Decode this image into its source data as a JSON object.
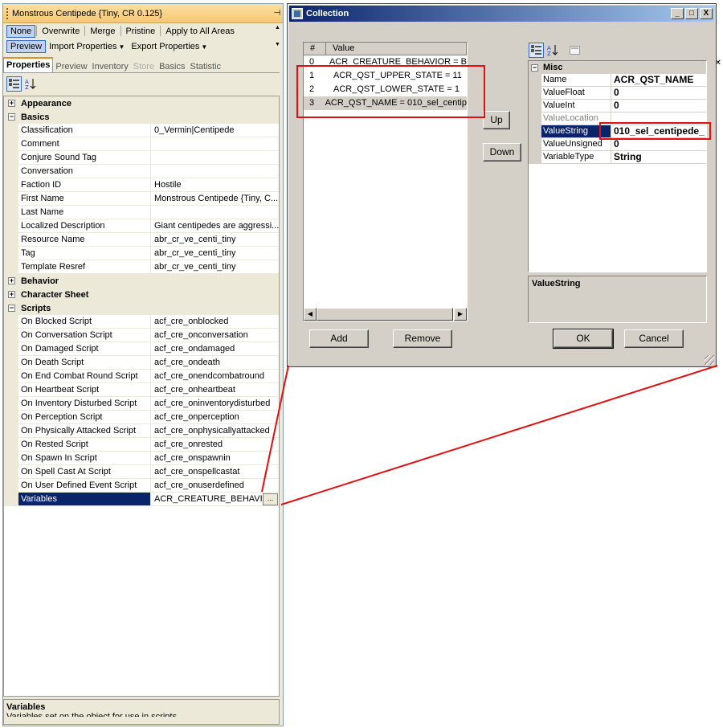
{
  "left_panel": {
    "title": "Monstrous Centipede {Tiny, CR 0.125}",
    "pin_glyph": "⊣",
    "toolbar_row1": [
      "None",
      "Overwrite",
      "Merge",
      "Pristine",
      "Apply to All Areas"
    ],
    "toolbar_row2": {
      "preview": "Preview",
      "import": "Import Properties",
      "export": "Export Properties"
    },
    "tabs": [
      "Properties",
      "Preview",
      "Inventory",
      "Store",
      "Basics",
      "Statistic"
    ],
    "categories": {
      "appearance": "Appearance",
      "basics": "Basics",
      "behavior": "Behavior",
      "character_sheet": "Character Sheet",
      "scripts": "Scripts"
    },
    "basics_props": [
      {
        "name": "Classification",
        "value": "0_Vermin|Centipede"
      },
      {
        "name": "Comment",
        "value": ""
      },
      {
        "name": "Conjure Sound Tag",
        "value": ""
      },
      {
        "name": "Conversation",
        "value": ""
      },
      {
        "name": "Faction ID",
        "value": "Hostile"
      },
      {
        "name": "First Name",
        "value": "Monstrous Centipede {Tiny, C..."
      },
      {
        "name": "Last Name",
        "value": ""
      },
      {
        "name": "Localized Description",
        "value": "Giant centipedes are aggressi..."
      },
      {
        "name": "Resource Name",
        "value": "abr_cr_ve_centi_tiny"
      },
      {
        "name": "Tag",
        "value": "abr_cr_ve_centi_tiny"
      },
      {
        "name": "Template Resref",
        "value": "abr_cr_ve_centi_tiny"
      }
    ],
    "script_props": [
      {
        "name": "On Blocked Script",
        "value": "acf_cre_onblocked"
      },
      {
        "name": "On Conversation Script",
        "value": "acf_cre_onconversation"
      },
      {
        "name": "On Damaged Script",
        "value": "acf_cre_ondamaged"
      },
      {
        "name": "On Death Script",
        "value": "acf_cre_ondeath"
      },
      {
        "name": "On End Combat Round Script",
        "value": "acf_cre_onendcombatround"
      },
      {
        "name": "On Heartbeat Script",
        "value": "acf_cre_onheartbeat"
      },
      {
        "name": "On Inventory Disturbed Script",
        "value": "acf_cre_oninventorydisturbed"
      },
      {
        "name": "On Perception Script",
        "value": "acf_cre_onperception"
      },
      {
        "name": "On Physically Attacked Script",
        "value": "acf_cre_onphysicallyattacked"
      },
      {
        "name": "On Rested Script",
        "value": "acf_cre_onrested"
      },
      {
        "name": "On Spawn In Script",
        "value": "acf_cre_onspawnin"
      },
      {
        "name": "On Spell Cast At Script",
        "value": "acf_cre_onspellcastat"
      },
      {
        "name": "On User Defined Event Script",
        "value": "acf_cre_onuserdefined"
      }
    ],
    "variables_prop": {
      "name": "Variables",
      "value": "ACR_CREATURE_BEHAVIOR",
      "button": "..."
    },
    "description": {
      "title": "Variables",
      "text": "Variables set on the object for use in scripts"
    }
  },
  "dialog": {
    "title": "Collection",
    "win_buttons": [
      "_",
      "□",
      "X"
    ],
    "list_headers": [
      "#",
      "Value"
    ],
    "list_items": [
      {
        "index": "0",
        "value": "ACR_CREATURE_BEHAVIOR = B"
      },
      {
        "index": "1",
        "value": "ACR_QST_UPPER_STATE = 11"
      },
      {
        "index": "2",
        "value": "ACR_QST_LOWER_STATE = 1"
      },
      {
        "index": "3",
        "value": "ACR_QST_NAME = 010_sel_centip"
      }
    ],
    "up_label": "Up",
    "down_label": "Down",
    "add_label": "Add",
    "remove_label": "Remove",
    "ok_label": "OK",
    "cancel_label": "Cancel",
    "grid_category": "Misc",
    "grid_props": [
      {
        "name": "Name",
        "value": "ACR_QST_NAME"
      },
      {
        "name": "ValueFloat",
        "value": "0"
      },
      {
        "name": "ValueInt",
        "value": "0"
      },
      {
        "name": "ValueLocation",
        "value": ""
      },
      {
        "name": "ValueString",
        "value": "010_sel_centipede_"
      },
      {
        "name": "ValueUnsigned",
        "value": "0"
      },
      {
        "name": "VariableType",
        "value": "String"
      }
    ],
    "help_title": "ValueString"
  },
  "colors": {
    "selection": "#0a246a",
    "annotation_red": "#e01010",
    "panel_title": "#f6c871",
    "tab_accent": "#e68b2c"
  }
}
